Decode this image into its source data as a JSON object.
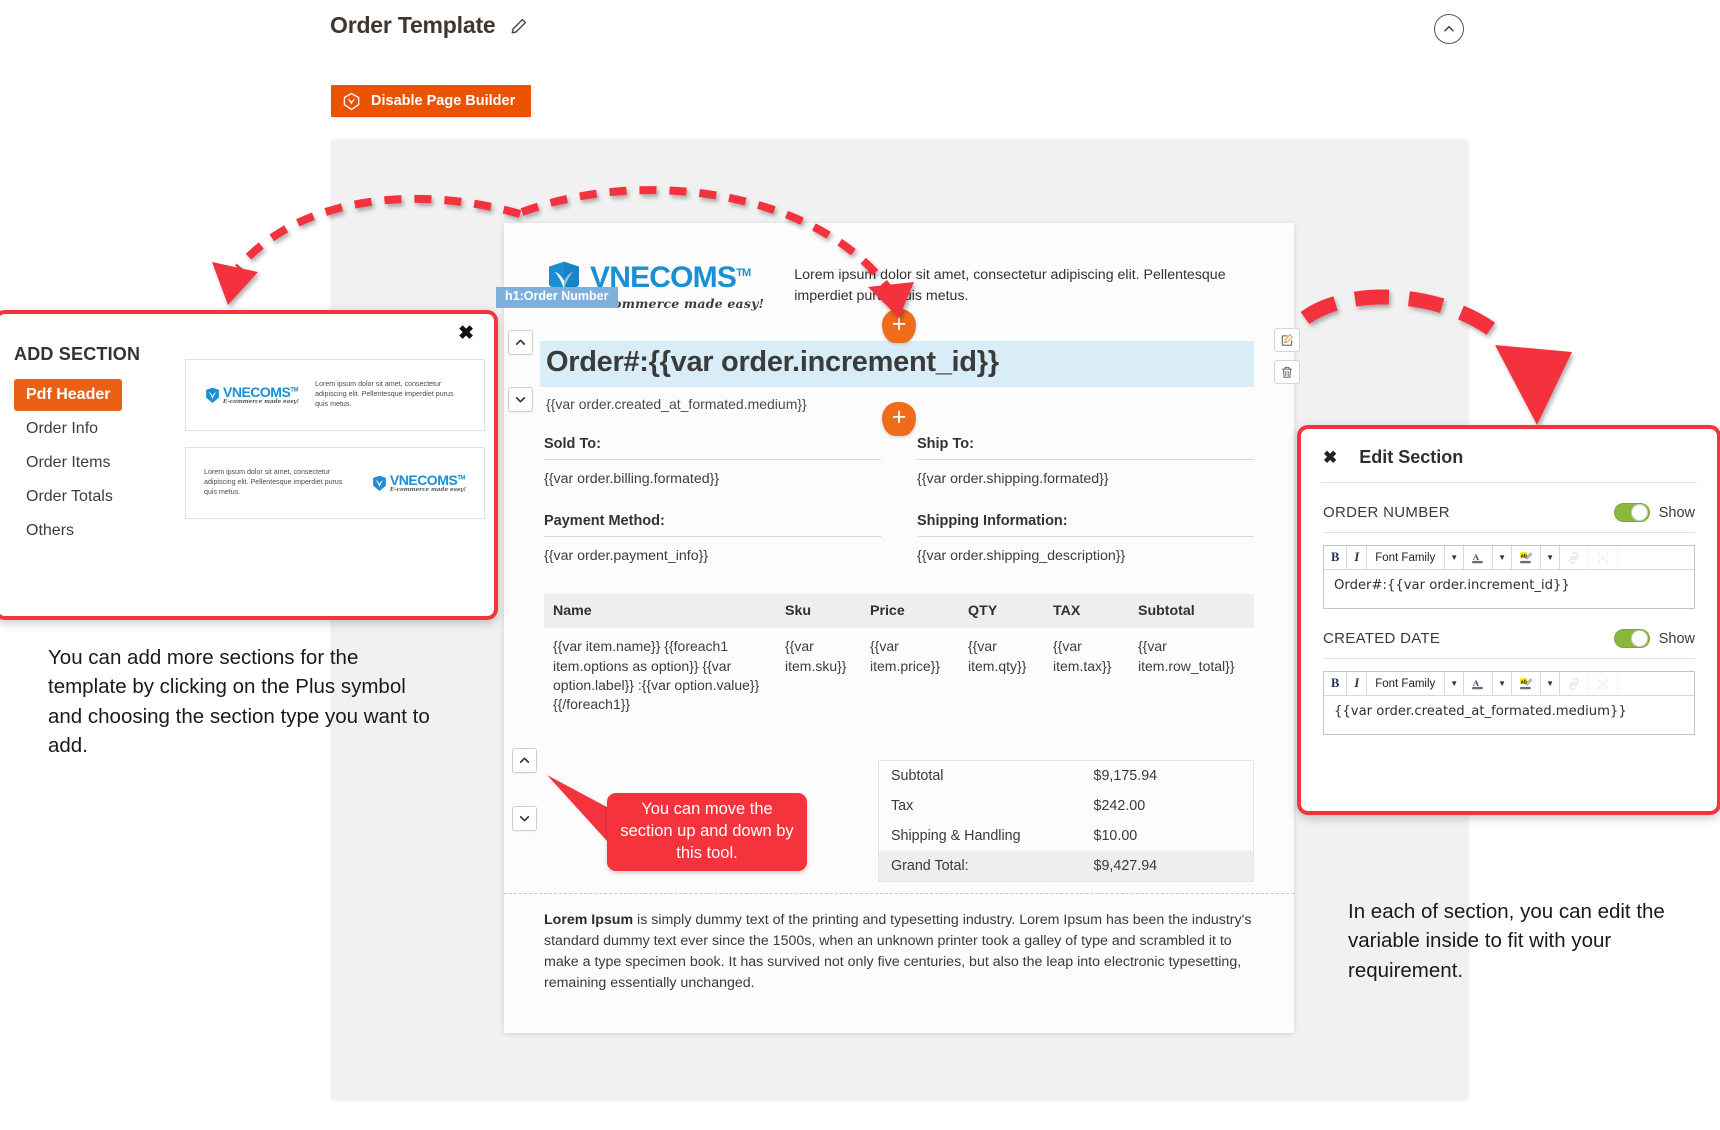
{
  "header": {
    "title": "Order Template",
    "edit_icon": "pencil-icon",
    "collapse_icon": "chevron-up-circle-icon"
  },
  "toolbar": {
    "disable_page_builder_label": "Disable Page Builder",
    "pb_icon": "page-builder-logo-icon"
  },
  "document": {
    "logo_word": "VNECOMS",
    "logo_tm": "TM",
    "logo_tagline": "E-commerce made easy!",
    "header_text": "Lorem ipsum dolor sit amet, consectetur adipiscing elit. Pellentesque imperdiet purus quis metus.",
    "section_tag": "h1:Order Number",
    "order_number": "Order#:{{var order.increment_id}}",
    "created_date": "{{var order.created_at_formated.medium}}",
    "sold_to_label": "Sold To:",
    "sold_to_value": "{{var order.billing.formated}}",
    "ship_to_label": "Ship To:",
    "ship_to_value": "{{var order.shipping.formated}}",
    "payment_method_label": "Payment Method:",
    "payment_method_value": "{{var order.payment_info}}",
    "shipping_info_label": "Shipping Information:",
    "shipping_info_value": "{{var order.shipping_description}}",
    "items_table": {
      "columns": [
        "Name",
        "Sku",
        "Price",
        "QTY",
        "TAX",
        "Subtotal"
      ],
      "rows": [
        [
          "{{var item.name}} {{foreach1 item.options as option}} {{var option.label}} :{{var option.value}} {{/foreach1}}",
          "{{var item.sku}}",
          "{{var item.price}}",
          "{{var item.qty}}",
          "{{var item.tax}}",
          "{{var item.row_total}}"
        ]
      ]
    },
    "totals": [
      {
        "label": "Subtotal",
        "value": "$9,175.94",
        "grand": false
      },
      {
        "label": "Tax",
        "value": "$242.00",
        "grand": false
      },
      {
        "label": "Shipping & Handling",
        "value": "$10.00",
        "grand": false
      },
      {
        "label": "Grand Total:",
        "value": "$9,427.94",
        "grand": true
      }
    ],
    "footer_bold": "Lorem Ipsum",
    "footer_text": " is simply dummy text of the printing and typesetting industry. Lorem Ipsum has been the industry's standard dummy text ever since the 1500s, when an unknown printer took a galley of type and scrambled it to make a type specimen book. It has survived not only five centuries, but also the leap into electronic typesetting, remaining essentially unchanged.",
    "plus_button_label": "+",
    "move_up_icon": "chevron-up-icon",
    "move_down_icon": "chevron-down-icon",
    "edit_icon": "edit-pencil-square-icon",
    "delete_icon": "trash-icon"
  },
  "add_section_panel": {
    "title": "ADD SECTION",
    "close_label": "✖",
    "items": [
      {
        "label": "Pdf Header",
        "active": true
      },
      {
        "label": "Order Info",
        "active": false
      },
      {
        "label": "Order Items",
        "active": false
      },
      {
        "label": "Order Totals",
        "active": false
      },
      {
        "label": "Others",
        "active": false
      }
    ],
    "thumbnails": [
      {
        "logo_word": "VNECOMS",
        "logo_tm": "TM",
        "tagline": "E-commerce made easy!",
        "text": "Lorem ipsum dolor sit amet, consectetur adipiscing elit. Pellentesque imperdiet purus quis metus.",
        "reversed": false
      },
      {
        "logo_word": "VNECOMS",
        "logo_tm": "TM",
        "tagline": "E-commerce made easy!",
        "text": "Lorem ipsum dolor sit amet, consectetur adipiscing elit. Pellentesque imperdiet purus quis metus.",
        "reversed": true
      }
    ]
  },
  "edit_section_panel": {
    "title": "Edit Section",
    "close_label": "✖",
    "fields": [
      {
        "label": "ORDER NUMBER",
        "toggle_label": "Show",
        "toggle_on": true,
        "content": "Order#:{{var order.increment_id}}",
        "toolbar": {
          "bold": "B",
          "italic": "I",
          "font_family": "Font Family",
          "text_color_icon": "text-color-icon",
          "highlight_icon": "text-highlight-icon",
          "link_icon": "link-icon",
          "unlink_icon": "unlink-icon"
        }
      },
      {
        "label": "CREATED DATE",
        "toggle_label": "Show",
        "toggle_on": true,
        "content": "{{var order.created_at_formated.medium}}",
        "toolbar": {
          "bold": "B",
          "italic": "I",
          "font_family": "Font Family",
          "text_color_icon": "text-color-icon",
          "highlight_icon": "text-highlight-icon",
          "link_icon": "link-icon",
          "unlink_icon": "unlink-icon"
        }
      }
    ]
  },
  "annotations": {
    "left": "You can add more sections for the template by clicking on the Plus symbol and choosing the section type you want to add.",
    "move_callout": "You can move the section up and down by this tool.",
    "right": "In each of section, you can edit the variable inside to fit with your requirement."
  },
  "colors": {
    "orange": "#eb5202",
    "annotation_red": "#f4333d",
    "brand_blue": "#1a8fd4",
    "toggle_green": "#8bb83c",
    "tag_blue": "#7eb0dd",
    "highlight_blue": "#d9edf9"
  }
}
